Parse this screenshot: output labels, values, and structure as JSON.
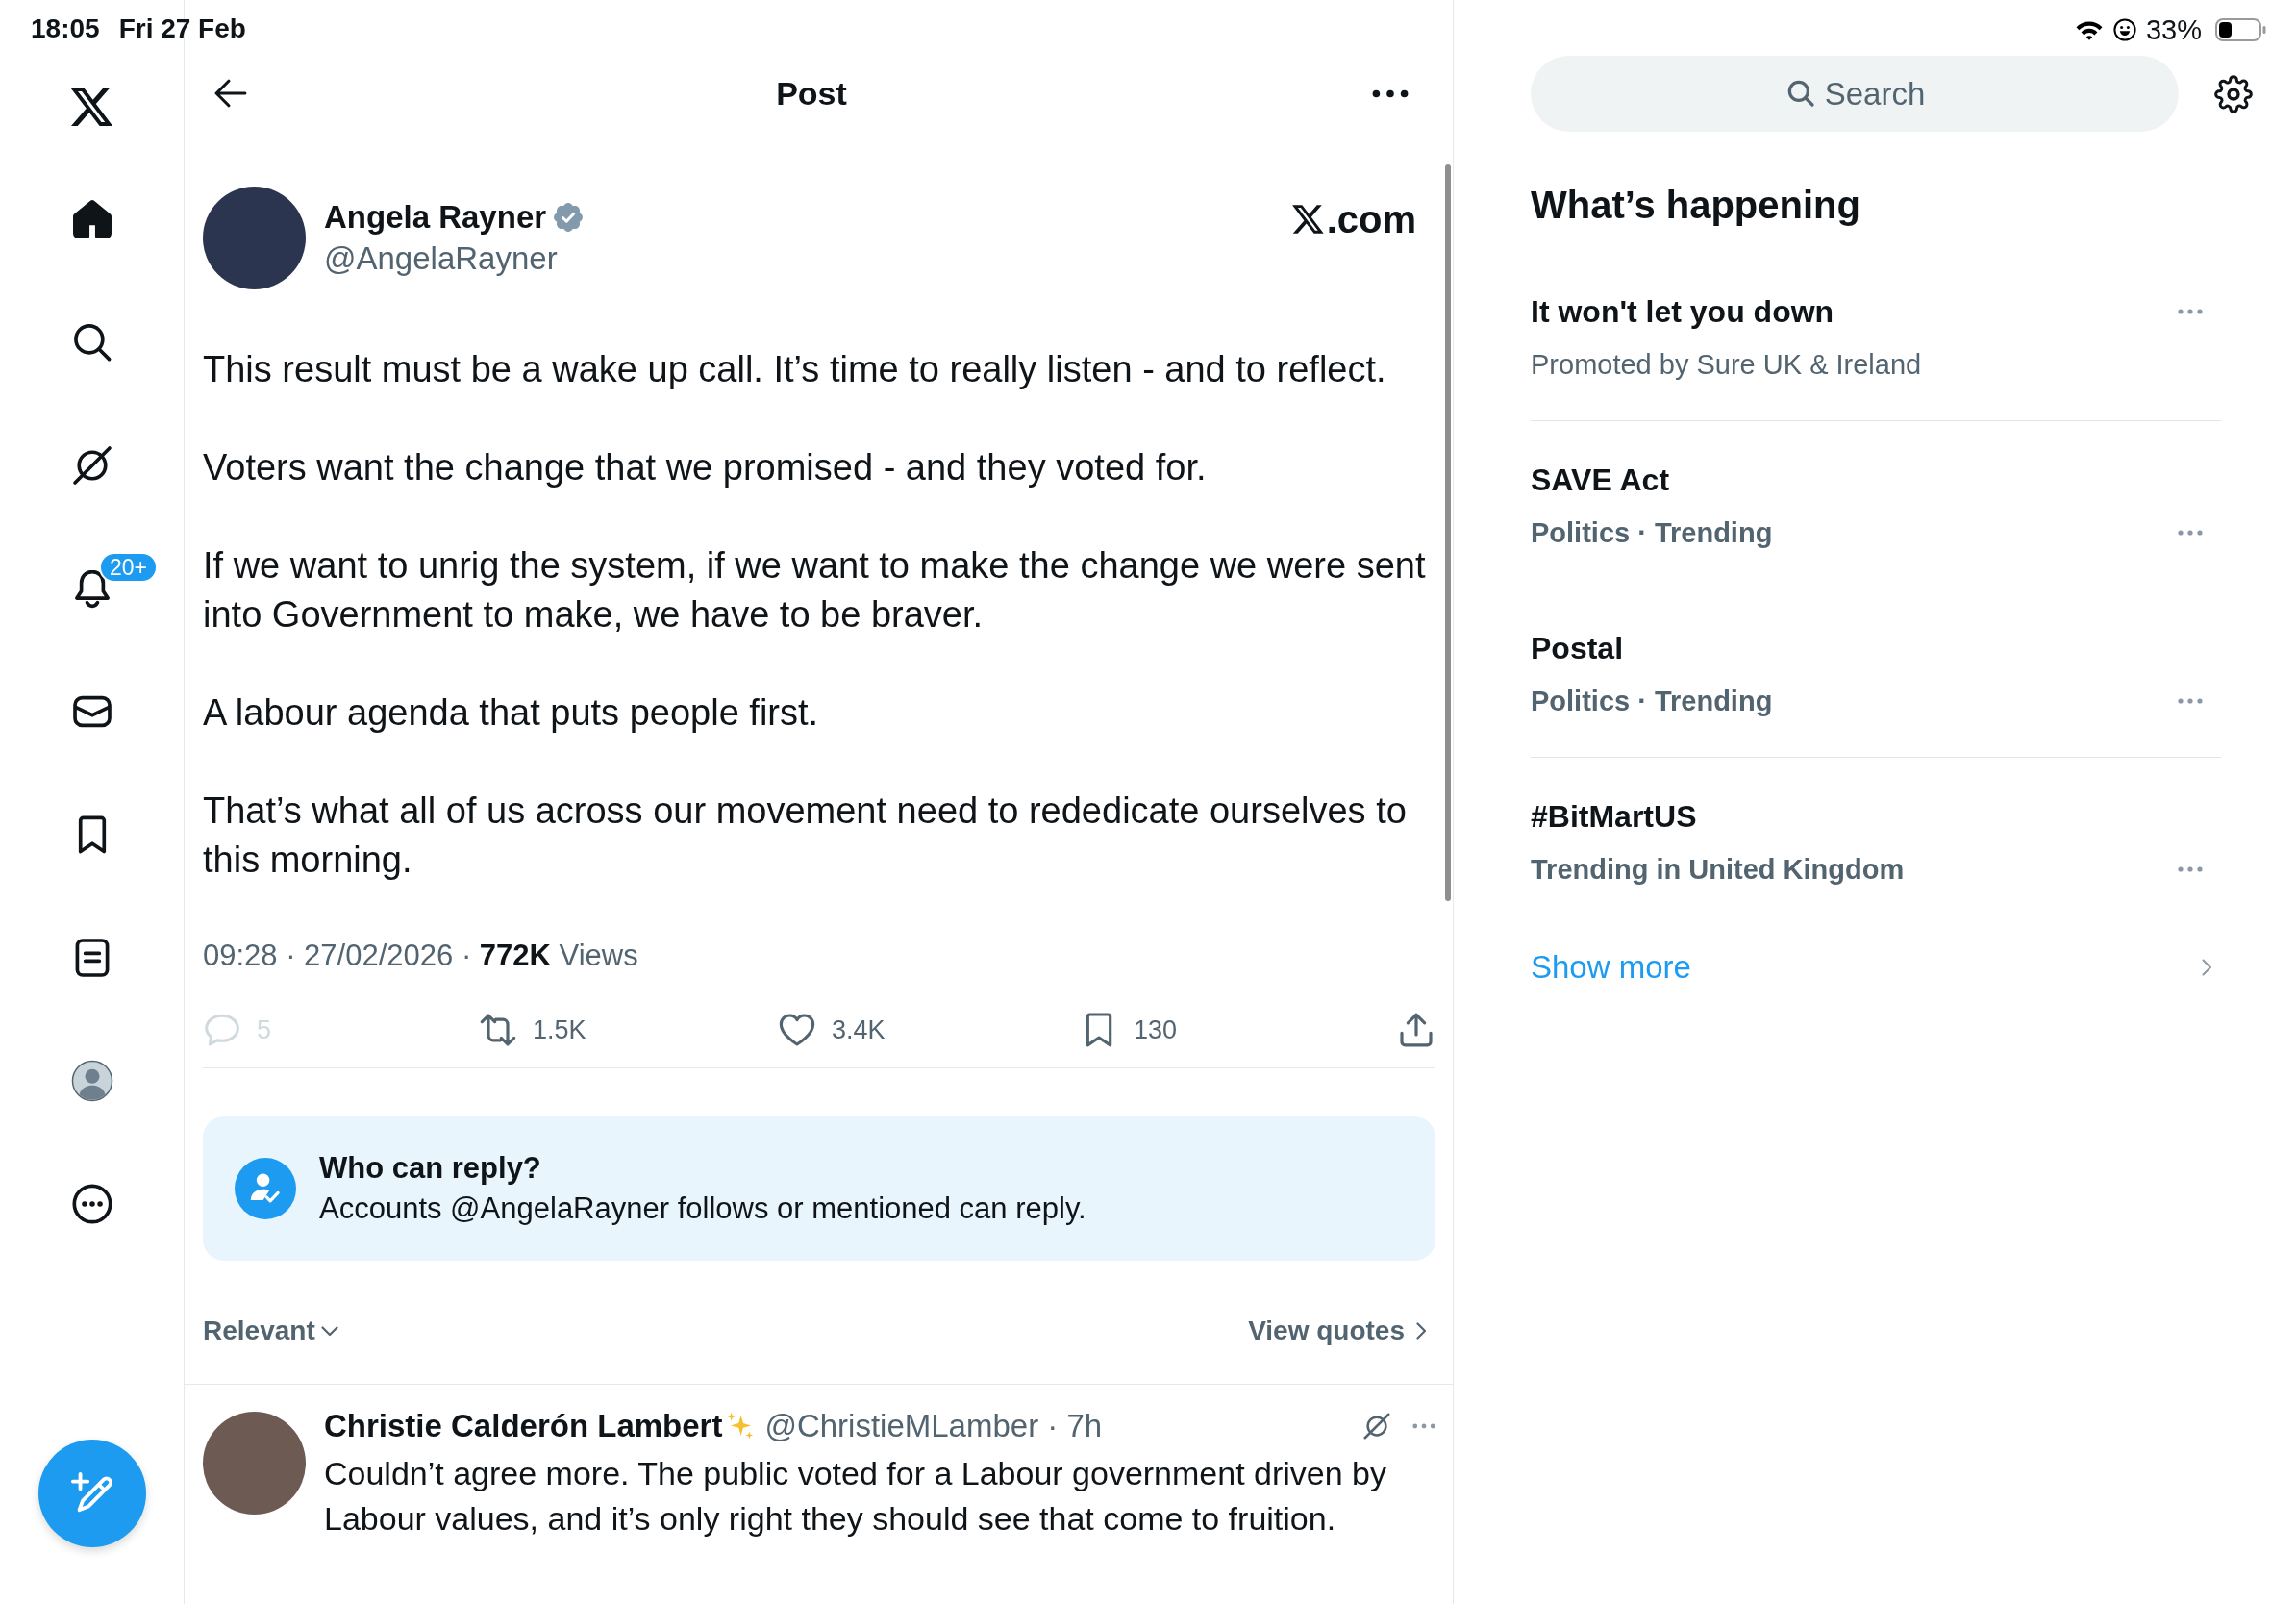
{
  "status_bar": {
    "time": "18:05",
    "date": "Fri 27 Feb",
    "battery": "33%"
  },
  "sidebar": {
    "items": [
      {
        "kind": "home",
        "selected": true
      },
      {
        "kind": "search",
        "selected": false
      },
      {
        "kind": "assistant",
        "selected": false
      },
      {
        "kind": "notifications",
        "selected": false,
        "badge": "20+"
      },
      {
        "kind": "messages",
        "selected": false
      },
      {
        "kind": "bookmarks",
        "selected": false
      },
      {
        "kind": "lists",
        "selected": false
      },
      {
        "kind": "profile",
        "selected": false
      },
      {
        "kind": "more",
        "selected": false
      }
    ]
  },
  "header": {
    "title": "Post"
  },
  "post": {
    "author": {
      "name": "Angela Rayner",
      "handle": "@AngelaRayner",
      "verified": true
    },
    "site_suffix": ".com",
    "paragraphs": [
      "This result must be a wake up call. It’s time to really listen - and to reflect.",
      "Voters want the change that we promised - and they voted for.",
      "If we want to unrig the system, if we want to make the change we were sent into Government to make, we have to be braver.",
      "A labour agenda that puts people first.",
      "That’s what all of us across our movement need to rededicate ourselves to this morning."
    ],
    "meta": "09:28 · 27/02/2026 · **772K** Views",
    "actions": [
      {
        "kind": "reply",
        "count": "5",
        "disabled": true
      },
      {
        "kind": "repost",
        "count": "1.5K",
        "disabled": false
      },
      {
        "kind": "like",
        "count": "3.4K",
        "disabled": false
      },
      {
        "kind": "bookmark",
        "count": "130",
        "disabled": false
      },
      {
        "kind": "share",
        "disabled": false
      }
    ],
    "reply_restriction": {
      "title": "Who can reply?",
      "text": "Accounts @AngelaRayner follows or mentioned can reply."
    }
  },
  "replies_bar": {
    "sort": "Relevant",
    "quotes_link": "View quotes"
  },
  "replies": [
    {
      "name": "Christie Calderón Lambert",
      "handle_time": "@ChristieMLamber · 7h",
      "text": "Couldn’t agree more. The public voted for a Labour government driven by Labour values, and it’s only right they should see that come to fruition."
    }
  ],
  "right_panel": {
    "search": {
      "placeholder": "Search"
    },
    "trends": {
      "title": "What’s happening",
      "items": [
        {
          "kind": "promoted",
          "title": "It won't let you down",
          "subtitle": "Promoted by Sure UK & Ireland"
        },
        {
          "kind": "trend",
          "title": "SAVE Act",
          "subtitle": "Politics · Trending"
        },
        {
          "kind": "trend",
          "title": "Postal",
          "subtitle": "Politics · Trending"
        },
        {
          "kind": "trend",
          "title": "#BitMartUS",
          "subtitle": "Trending in United Kingdom"
        }
      ],
      "show_more": "Show more"
    }
  }
}
